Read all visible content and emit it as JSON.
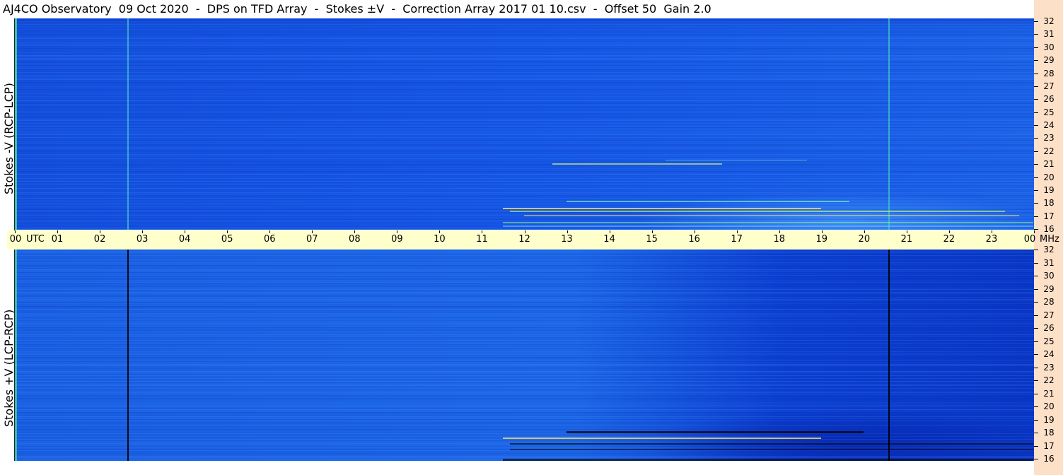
{
  "title": "AJ4CO Observatory  09 Oct 2020  -  DPS on TFD Array  -  Stokes ±V  -  Correction Array 2017 01 10.csv  -  Offset 50  Gain 2.0",
  "panels": {
    "top_label": "Stokes -V (RCP-LCP)",
    "bottom_label": "Stokes +V (LCP-RCP)"
  },
  "time_axis": {
    "unit_left": "UTC",
    "unit_right": "MHz",
    "ticks": [
      "00",
      "01",
      "02",
      "03",
      "04",
      "05",
      "06",
      "07",
      "08",
      "09",
      "10",
      "11",
      "12",
      "13",
      "14",
      "15",
      "16",
      "17",
      "18",
      "19",
      "20",
      "21",
      "22",
      "23",
      "00"
    ]
  },
  "freq_axis": {
    "ticks": [
      "32",
      "31",
      "30",
      "29",
      "28",
      "27",
      "26",
      "25",
      "24",
      "23",
      "22",
      "21",
      "20",
      "19",
      "18",
      "17",
      "16"
    ]
  },
  "colors": {
    "background": "#1a5fe0",
    "strip": "#fde0c8",
    "time_band": "#ffffcc"
  },
  "chart_data": {
    "type": "heatmap",
    "x_range": [
      "00",
      "00"
    ],
    "y_range": [
      16,
      32
    ],
    "xlabel": "UTC",
    "ylabel": "MHz"
  }
}
